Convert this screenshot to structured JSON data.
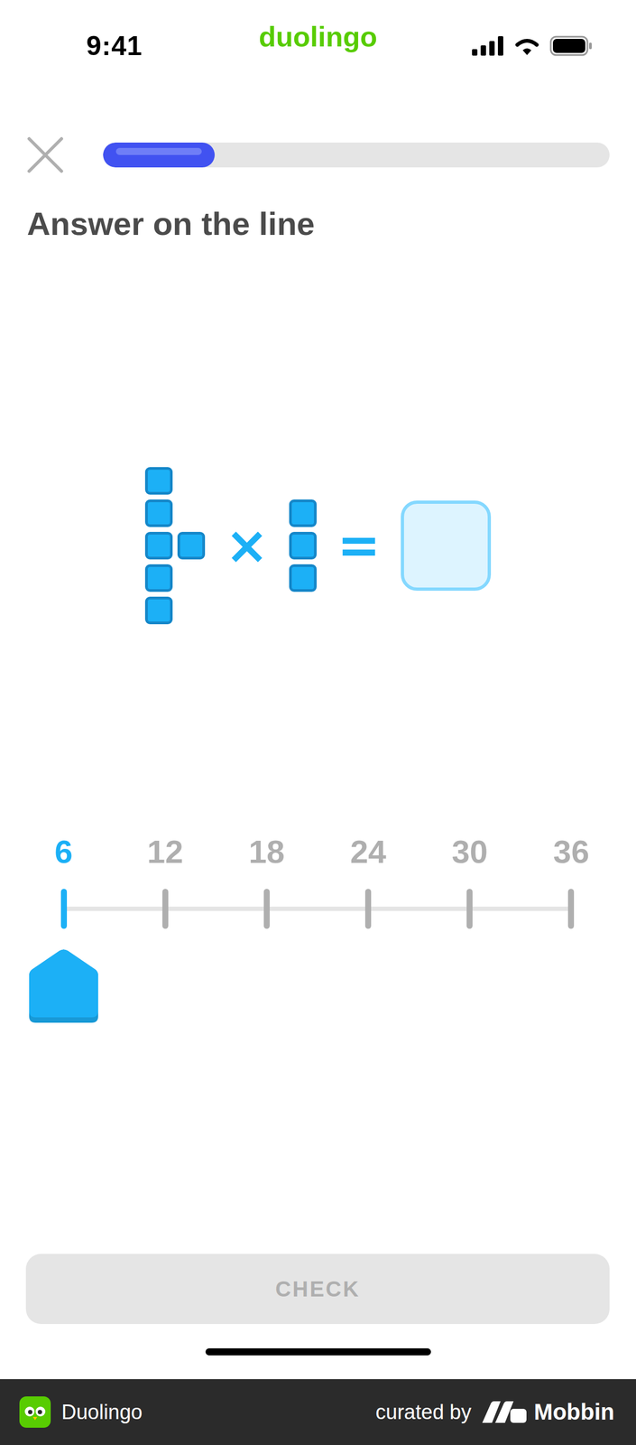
{
  "status_bar": {
    "time": "9:41",
    "app": "duolingo"
  },
  "progress": {
    "level": 0.22
  },
  "title": "Answer on the line",
  "equation": {
    "factors": [
      {
        "columns": [
          5,
          1
        ]
      },
      {
        "columns": [
          3
        ]
      }
    ],
    "operator": "×",
    "equals": "="
  },
  "number_line": {
    "ticks": [
      {
        "label": "6",
        "selected": true
      },
      {
        "label": "12",
        "selected": false
      },
      {
        "label": "18",
        "selected": false
      },
      {
        "label": "24",
        "selected": false
      },
      {
        "label": "30",
        "selected": false
      },
      {
        "label": "36",
        "selected": false
      }
    ],
    "level": 0
  },
  "check_button": {
    "label": "CHECK",
    "disabled": true
  },
  "footer": {
    "app": "Duolingo",
    "curated_by": "curated by",
    "brand": "Mobbin"
  }
}
